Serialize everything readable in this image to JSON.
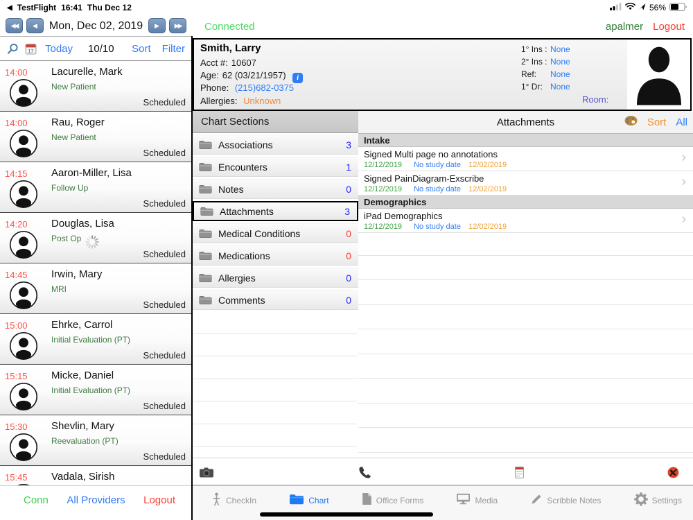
{
  "colors": {
    "accent_blue": "#2e7cf6",
    "count_blue": "#2424ff",
    "alert_red": "#fb3b30",
    "green_bright": "#4cd964",
    "green_dark": "#3d7a3f",
    "orange": "#f0a030",
    "room_purple": "#5856d6"
  },
  "icons": {
    "back_triangle": "◀",
    "prev_day": "◀",
    "prev_day_fast": "◀◀",
    "next_day": "▶",
    "next_day_fast": "▶▶",
    "chevron_right": "›"
  },
  "status_bar": {
    "back_app": "TestFlight",
    "time": "16:41",
    "date": "Thu Dec 12",
    "battery_pct": "56%"
  },
  "left_panel": {
    "nav": {
      "date_label": "Mon, Dec 02, 2019"
    },
    "toolbar": {
      "today": "Today",
      "count": "10/10",
      "sort": "Sort",
      "filter": "Filter"
    },
    "appointments": [
      {
        "time": "14:00",
        "name": "Lacurelle, Mark",
        "type": "New Patient",
        "status": "Scheduled"
      },
      {
        "time": "14:00",
        "name": "Rau, Roger",
        "type": "New Patient",
        "status": "Scheduled"
      },
      {
        "time": "14:15",
        "name": "Aaron-Miller, Lisa",
        "type": "Follow Up",
        "status": "Scheduled"
      },
      {
        "time": "14:20",
        "name": "Douglas, Lisa",
        "type": "Post Op",
        "status": "Scheduled"
      },
      {
        "time": "14:45",
        "name": "Irwin, Mary",
        "type": "MRI",
        "status": "Scheduled"
      },
      {
        "time": "15:00",
        "name": "Ehrke, Carrol",
        "type": "Initial Evaluation (PT)",
        "status": "Scheduled"
      },
      {
        "time": "15:15",
        "name": "Micke, Daniel",
        "type": "Initial Evaluation (PT)",
        "status": "Scheduled"
      },
      {
        "time": "15:30",
        "name": "Shevlin, Mary",
        "type": "Reevaluation (PT)",
        "status": "Scheduled"
      },
      {
        "time": "15:45",
        "name": "Vadala, Sirish",
        "type": "",
        "status": ""
      }
    ],
    "footer": {
      "conn": "Conn",
      "providers": "All Providers",
      "logout": "Logout"
    }
  },
  "header": {
    "connected": "Connected",
    "user": "apalmer",
    "logout": "Logout"
  },
  "patient": {
    "name": "Smith, Larry",
    "acct_label": "Acct #:",
    "acct": "10607",
    "age_label": "Age:",
    "age": "62 (03/21/1957)",
    "phone_label": "Phone:",
    "phone": "(215)682-0375",
    "allergies_label": "Allergies:",
    "allergies": "Unknown",
    "ins1_label": "1° Ins :",
    "ins1": "None",
    "ins2_label": "2° Ins :",
    "ins2": "None",
    "ref_label": "Ref:",
    "ref": "None",
    "dr1_label": "1° Dr:",
    "dr1": "None",
    "room_label": "Room:"
  },
  "chart_sections": {
    "title": "Chart Sections",
    "items": [
      {
        "label": "Associations",
        "count": "3",
        "count_color": "#2424ff"
      },
      {
        "label": "Encounters",
        "count": "1",
        "count_color": "#2424ff"
      },
      {
        "label": "Notes",
        "count": "0",
        "count_color": "#2424ff"
      },
      {
        "label": "Attachments",
        "count": "3",
        "count_color": "#2424ff"
      },
      {
        "label": "Medical Conditions",
        "count": "0",
        "count_color": "#fb3b30"
      },
      {
        "label": "Medications",
        "count": "0",
        "count_color": "#fb3b30"
      },
      {
        "label": "Allergies",
        "count": "0",
        "count_color": "#2424ff"
      },
      {
        "label": "Comments",
        "count": "0",
        "count_color": "#2424ff"
      }
    ]
  },
  "attachments": {
    "title": "Attachments",
    "sort": "Sort",
    "all": "All",
    "groups": [
      {
        "header": "Intake",
        "items": [
          {
            "title": "Signed Multi page no annotations",
            "date1": "12/12/2019",
            "study": "No study date",
            "date2": "12/02/2019"
          },
          {
            "title": "Signed PainDiagram-Exscribe",
            "date1": "12/12/2019",
            "study": "No study date",
            "date2": "12/02/2019"
          }
        ]
      },
      {
        "header": "Demographics",
        "items": [
          {
            "title": "iPad Demographics",
            "date1": "12/12/2019",
            "study": "No study date",
            "date2": "12/02/2019"
          }
        ]
      }
    ]
  },
  "tab_bar": {
    "tabs": [
      {
        "label": "CheckIn"
      },
      {
        "label": "Chart"
      },
      {
        "label": "Office Forms"
      },
      {
        "label": "Media"
      },
      {
        "label": "Scribble Notes"
      },
      {
        "label": "Settings"
      }
    ]
  }
}
